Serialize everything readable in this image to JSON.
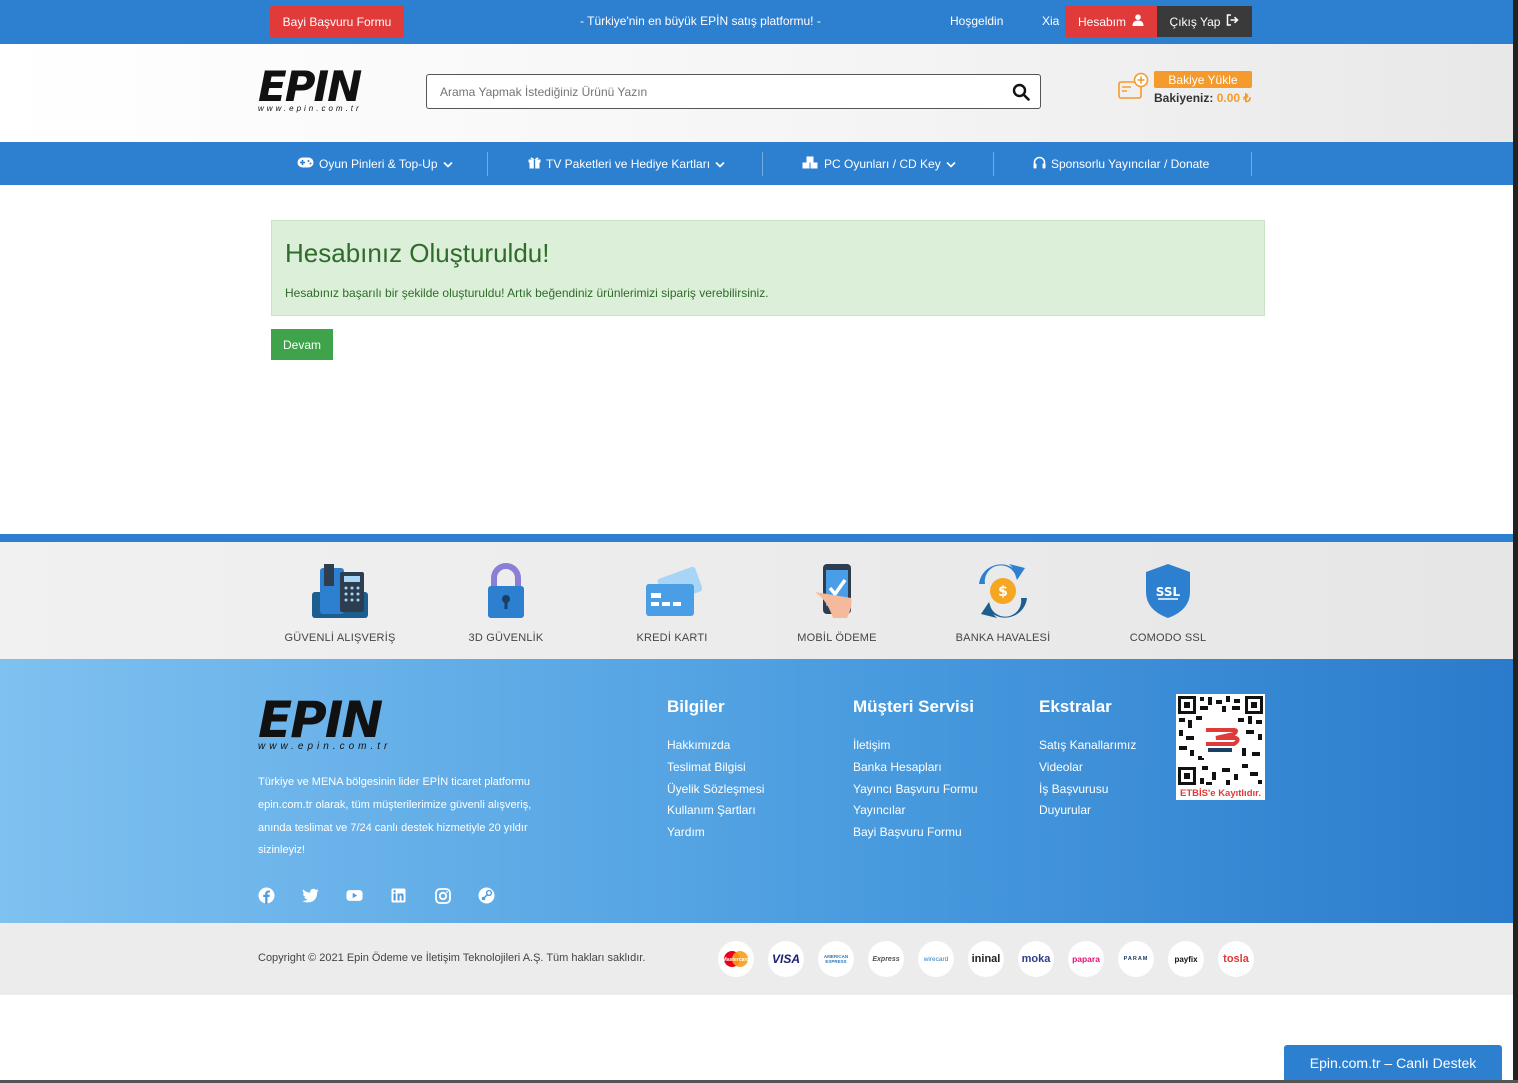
{
  "topbar": {
    "dealer_button": "Bayi Başvuru Formu",
    "tagline": "- Türkiye'nin en büyük EPİN satış platformu! -",
    "welcome": "Hoşgeldin",
    "username": "Xia",
    "account_button": "Hesabım",
    "logout_button": "Çıkış Yap"
  },
  "header": {
    "logo": "EPIN",
    "logo_sub": "www.epin.com.tr",
    "search_placeholder": "Arama Yapmak İstediğiniz Ürünü Yazın",
    "topup_button": "Bakiye Yükle",
    "balance_label": "Bakiyeniz:",
    "balance_value": "0.00 ₺"
  },
  "nav": [
    {
      "label": "Oyun Pinleri & Top-Up",
      "icon": "gamepad-icon"
    },
    {
      "label": "TV Paketleri ve Hediye Kartları",
      "icon": "gift-icon"
    },
    {
      "label": "PC Oyunları / CD Key",
      "icon": "cubes-icon"
    },
    {
      "label": "Sponsorlu Yayıncılar / Donate",
      "icon": "headphones-icon"
    }
  ],
  "main": {
    "alert_title": "Hesabınız Oluşturuldu!",
    "alert_text": "Hesabınız başarılı bir şekilde oluşturuldu! Artık beğendiniz ürünlerimizi sipariş verebilirsiniz.",
    "continue_button": "Devam"
  },
  "security": [
    {
      "label": "GÜVENLİ ALIŞVERİŞ",
      "icon": "phone-icon"
    },
    {
      "label": "3D GÜVENLİK",
      "icon": "padlock-icon"
    },
    {
      "label": "KREDİ KARTI",
      "icon": "credit-card-icon"
    },
    {
      "label": "MOBİL ÖDEME",
      "icon": "mobile-payment-icon"
    },
    {
      "label": "BANKA HAVALESİ",
      "icon": "bank-transfer-icon"
    },
    {
      "label": "COMODO SSL",
      "icon": "ssl-shield-icon"
    }
  ],
  "footer": {
    "description": "Türkiye ve MENA bölgesinin lider EPİN ticaret platformu epin.com.tr olarak, tüm müşterilerimize güvenli alışveriş, anında teslimat ve 7/24 canlı destek hizmetiyle 20 yıldır sizinleyiz!",
    "columns": [
      {
        "title": "Bilgiler",
        "links": [
          "Hakkımızda",
          "Teslimat Bilgisi",
          "Üyelik Sözleşmesi",
          "Kullanım Şartları",
          "Yardım"
        ]
      },
      {
        "title": "Müşteri Servisi",
        "links": [
          "İletişim",
          "Banka Hesapları",
          "Yayıncı Başvuru Formu",
          "Yayıncılar",
          "Bayi Başvuru Formu"
        ]
      },
      {
        "title": "Ekstralar",
        "links": [
          "Satış Kanallarımız",
          "Videolar",
          "İş Başvurusu",
          "Duyurular"
        ]
      }
    ],
    "etbis_label": "ETBİS'e Kayıtlıdır.",
    "social": [
      "facebook-icon",
      "twitter-icon",
      "youtube-icon",
      "linkedin-icon",
      "instagram-icon",
      "steam-icon"
    ]
  },
  "copyright": {
    "text": "Copyright © 2021 Epin Ödeme ve İletişim Teknolojileri A.Ş. Tüm hakları saklıdır.",
    "payments": [
      "Mastercard",
      "VISA",
      "AMERICAN EXPRESS",
      "Express",
      "wirecard",
      "ininal",
      "moka",
      "papara",
      "PARAM",
      "payfix",
      "tosla"
    ]
  },
  "chat_button": "Epin.com.tr – Canlı Destek",
  "colors": {
    "primary": "#2d7fd0",
    "danger": "#e03a3a",
    "orange": "#f59a2c",
    "success": "#3ea34a"
  }
}
